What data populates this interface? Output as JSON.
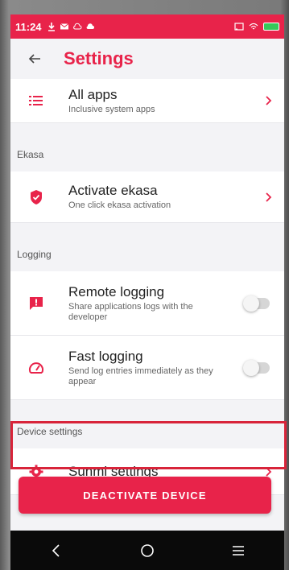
{
  "status_bar": {
    "time": "11:24",
    "icons_left": [
      "download-icon",
      "email-icon",
      "cloud-off-icon",
      "cloud-icon"
    ],
    "icons_right": [
      "cast-icon",
      "wifi-icon",
      "battery-icon"
    ]
  },
  "app_bar": {
    "title": "Settings",
    "back_icon": "arrow-left-icon"
  },
  "colors": {
    "accent": "#e8234a",
    "background": "#f3f3f6",
    "highlight_border": "#d8243a"
  },
  "items": {
    "all_apps": {
      "label": "All apps",
      "sub": "Inclusive system apps",
      "icon": "list-icon"
    },
    "ekasa_section": "Ekasa",
    "activate_ekasa": {
      "label": "Activate ekasa",
      "sub": "One click ekasa activation",
      "icon": "shield-check-icon"
    },
    "logging_section": "Logging",
    "remote_logging": {
      "label": "Remote logging",
      "sub": "Share applications logs with the developer",
      "icon": "report-icon",
      "enabled": false
    },
    "fast_logging": {
      "label": "Fast logging",
      "sub": "Send log entries immediately as they appear",
      "icon": "speedometer-icon",
      "enabled": false
    },
    "device_section": "Device settings",
    "sunmi_settings": {
      "label": "Sunmi settings",
      "icon": "gear-icon"
    }
  },
  "deactivate_button": "DEACTIVATE DEVICE",
  "nav": [
    "back-nav-icon",
    "home-nav-icon",
    "menu-nav-icon"
  ]
}
